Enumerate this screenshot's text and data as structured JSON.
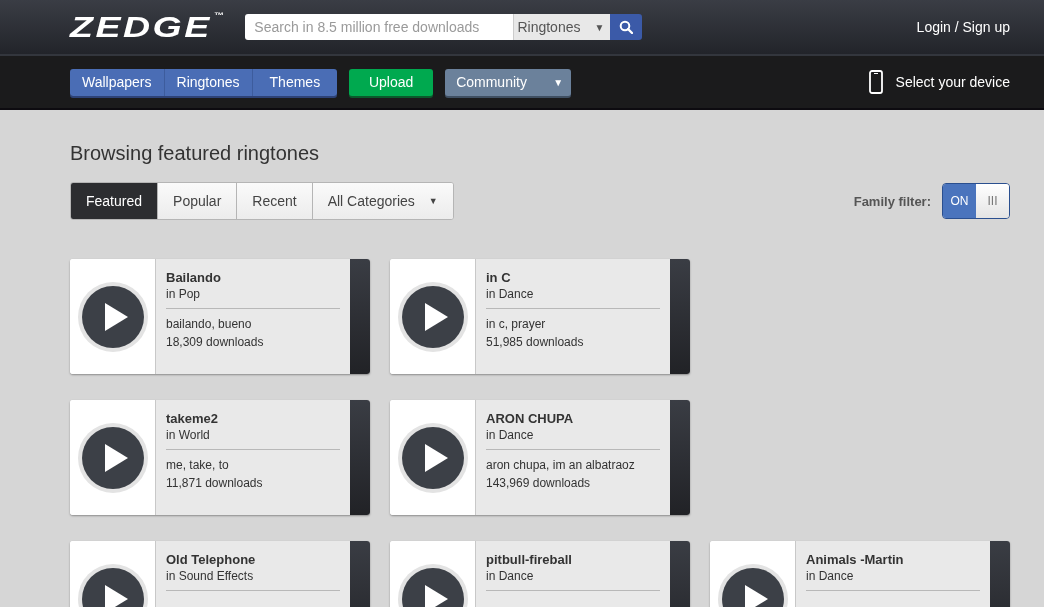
{
  "header": {
    "logo": "ZEDGE",
    "trademark": "™",
    "search": {
      "placeholder": "Search in 8.5 million free downloads",
      "category": "Ringtones",
      "caret": "▼"
    },
    "login": "Login / Sign up"
  },
  "nav": {
    "sections": [
      {
        "label": "Wallpapers",
        "selected": false
      },
      {
        "label": "Ringtones",
        "selected": false
      },
      {
        "label": "Themes",
        "selected": false
      }
    ],
    "upload": "Upload",
    "community": "Community",
    "community_caret": "▼",
    "device": "Select your device"
  },
  "page_title": "Browsing featured ringtones",
  "filters": [
    {
      "label": "Featured",
      "selected": true
    },
    {
      "label": "Popular",
      "selected": false
    },
    {
      "label": "Recent",
      "selected": false
    },
    {
      "label": "All Categories",
      "selected": false,
      "caret": "▼"
    }
  ],
  "family_filter": {
    "label": "Family filter:",
    "on": true,
    "on_label": "ON",
    "off_label": "III"
  },
  "rows": [
    [
      {
        "title": "Bailando",
        "category": "in Pop",
        "tags": "bailando, bueno",
        "downloads": "18,309 downloads"
      },
      {
        "title": "in C",
        "category": "in Dance",
        "tags": "in c, prayer",
        "downloads": "51,985 downloads"
      }
    ],
    [
      {
        "title": "takeme2",
        "category": "in World",
        "tags": "me, take, to",
        "downloads": "11,871 downloads"
      },
      {
        "title": "ARON CHUPA",
        "category": "in Dance",
        "tags": "aron chupa, im an albatraoz",
        "downloads": "143,969 downloads"
      }
    ],
    [
      {
        "title": "Old Telephone",
        "category": "in Sound Effects"
      },
      {
        "title": "pitbull-fireball",
        "category": "in Dance"
      },
      {
        "title": "Animals -Martin",
        "category": "in Dance"
      }
    ]
  ]
}
